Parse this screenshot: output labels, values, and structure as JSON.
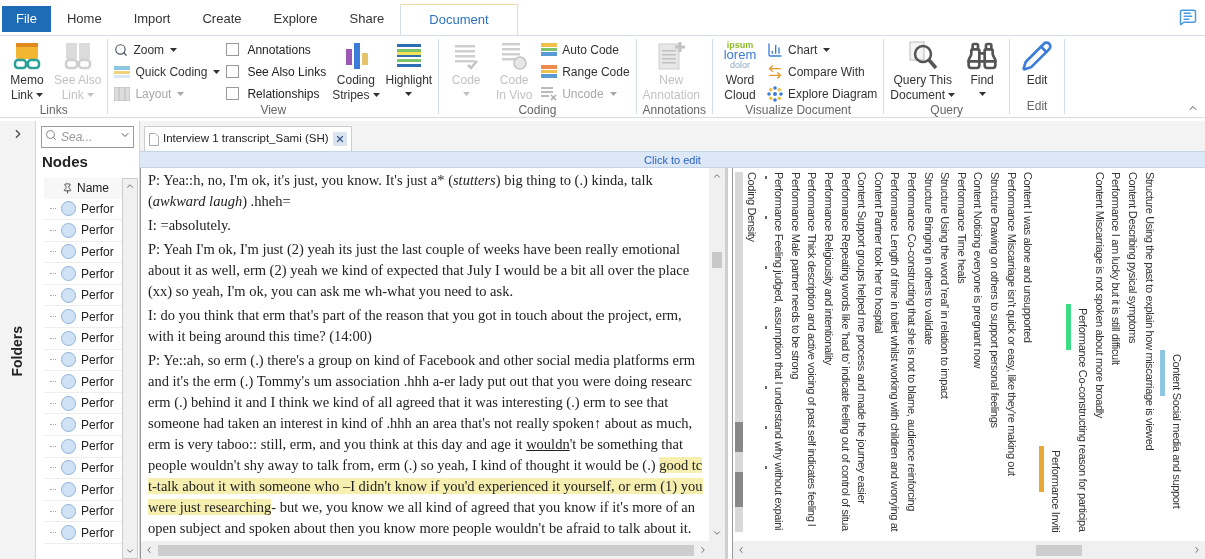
{
  "tabs": [
    {
      "label": "File",
      "kind": "file",
      "selected": false
    },
    {
      "label": "Home",
      "kind": "tab",
      "selected": false
    },
    {
      "label": "Import",
      "kind": "tab",
      "selected": false
    },
    {
      "label": "Create",
      "kind": "tab",
      "selected": false
    },
    {
      "label": "Explore",
      "kind": "tab",
      "selected": false
    },
    {
      "label": "Share",
      "kind": "tab",
      "selected": false
    },
    {
      "label": "Document",
      "kind": "tab",
      "selected": true
    }
  ],
  "ribbon": {
    "groups": [
      {
        "label": "Links",
        "items": [
          {
            "kind": "large",
            "lines": [
              "Memo",
              "Link"
            ],
            "dropdown": true,
            "disabled": false
          },
          {
            "kind": "large",
            "lines": [
              "See Also",
              "Link"
            ],
            "dropdown": true,
            "disabled": true
          }
        ]
      },
      {
        "label": "View",
        "items": [
          {
            "kind": "stack",
            "items": [
              {
                "kind": "small",
                "label": "Zoom",
                "dropdown": true,
                "disabled": false
              },
              {
                "kind": "small",
                "label": "Quick Coding",
                "dropdown": true,
                "disabled": false
              },
              {
                "kind": "small",
                "label": "Layout",
                "dropdown": true,
                "disabled": true
              }
            ]
          },
          {
            "kind": "stack",
            "items": [
              {
                "kind": "check",
                "label": "Annotations",
                "checked": false
              },
              {
                "kind": "check",
                "label": "See Also Links",
                "checked": false
              },
              {
                "kind": "check",
                "label": "Relationships",
                "checked": false
              }
            ]
          },
          {
            "kind": "large",
            "lines": [
              "Coding",
              "Stripes"
            ],
            "dropdown": true,
            "disabled": false
          },
          {
            "kind": "large",
            "lines": [
              "Highlight"
            ],
            "dropdown": true,
            "disabled": false
          }
        ]
      },
      {
        "label": "Coding",
        "items": [
          {
            "kind": "large",
            "lines": [
              "Code"
            ],
            "dropdown": true,
            "disabled": true
          },
          {
            "kind": "large",
            "lines": [
              "Code",
              "In Vivo"
            ],
            "dropdown": false,
            "disabled": true
          },
          {
            "kind": "stack",
            "items": [
              {
                "kind": "small",
                "label": "Auto Code",
                "dropdown": false,
                "disabled": false
              },
              {
                "kind": "small",
                "label": "Range Code",
                "dropdown": false,
                "disabled": false
              },
              {
                "kind": "small",
                "label": "Uncode",
                "dropdown": true,
                "disabled": true
              }
            ]
          }
        ]
      },
      {
        "label": "Annotations",
        "items": [
          {
            "kind": "large",
            "lines": [
              "New",
              "Annotation"
            ],
            "dropdown": false,
            "disabled": true
          }
        ]
      },
      {
        "label": "Visualize Document",
        "items": [
          {
            "kind": "large",
            "lines": [
              "Word",
              "Cloud"
            ],
            "dropdown": false,
            "disabled": false,
            "icon_words": [
              "ipsum",
              "lorem",
              "dolor"
            ]
          },
          {
            "kind": "stack",
            "items": [
              {
                "kind": "small",
                "label": "Chart",
                "dropdown": true,
                "disabled": false
              },
              {
                "kind": "small",
                "label": "Compare With",
                "dropdown": false,
                "disabled": false
              },
              {
                "kind": "small",
                "label": "Explore Diagram",
                "dropdown": false,
                "disabled": false
              }
            ]
          }
        ]
      },
      {
        "label": "Query",
        "items": [
          {
            "kind": "large",
            "lines": [
              "Query This",
              "Document"
            ],
            "dropdown": true,
            "disabled": false
          },
          {
            "kind": "large",
            "lines": [
              "Find"
            ],
            "dropdown": true,
            "disabled": false
          }
        ]
      },
      {
        "label": "Edit",
        "items": [
          {
            "kind": "large",
            "lines": [
              "Edit"
            ],
            "dropdown": false,
            "disabled": false
          }
        ]
      }
    ]
  },
  "navigation": {
    "panel_label": "Folders",
    "search": {
      "placeholder": "Sea..."
    },
    "title": "Nodes",
    "column": "Name",
    "items": [
      {
        "label": "Perfor"
      },
      {
        "label": "Perfor"
      },
      {
        "label": "Perfor"
      },
      {
        "label": "Perfor"
      },
      {
        "label": "Perfor"
      },
      {
        "label": "Perfor"
      },
      {
        "label": "Perfor"
      },
      {
        "label": "Perfor"
      },
      {
        "label": "Perfor"
      },
      {
        "label": "Perfor"
      },
      {
        "label": "Perfor"
      },
      {
        "label": "Perfor"
      },
      {
        "label": "Perfor"
      },
      {
        "label": "Perfor"
      },
      {
        "label": "Perfor"
      },
      {
        "label": "Perfor"
      }
    ]
  },
  "document": {
    "tab": "Interview 1 transcript_Sami (SH)",
    "edit_bar": "Click to edit",
    "paragraphs": [
      [
        [
          {
            "kind": "plain",
            "text": "P: Yea::h, no, I'm ok, it's just, you know. It's just a* (*stutters*) big thing to (.) kinda, talk"
          }
        ],
        [
          {
            "kind": "plain",
            "text": "(*awkward laugh*) .hheh="
          }
        ]
      ],
      [
        [
          {
            "kind": "plain",
            "text": "I: =absolutely."
          }
        ]
      ],
      [
        [
          {
            "kind": "plain",
            "text": "P: Yeah I'm ok, I'm just (2) yeah its just the last couple of weeks have been really emotional"
          }
        ],
        [
          {
            "kind": "plain",
            "text": "about it as well, erm (2) yeah we kind of expected that July I would be a bit all over the place"
          }
        ],
        [
          {
            "kind": "plain",
            "text": "(xx) so yeah, I'm ok, you can ask me wh-what you need to ask."
          }
        ]
      ],
      [
        [
          {
            "kind": "plain",
            "text": "I: do you think that erm that's part of the reason that you got in touch about the project, erm,"
          }
        ],
        [
          {
            "kind": "plain",
            "text": "with it being around this time? (14:00)"
          }
        ]
      ],
      [
        [
          {
            "kind": "plain",
            "text": "P: Ye::ah, so erm (.) there's a group on kind of Facebook and other social media platforms erm"
          }
        ],
        [
          {
            "kind": "plain",
            "text": "and it's the erm (.) Tommy's um association .hhh a-er lady put out that you were doing researc"
          }
        ],
        [
          {
            "kind": "plain",
            "text": "erm (.) behind it and I think we kind of all agreed that it was interesting (.) erm to see that"
          }
        ],
        [
          {
            "kind": "plain",
            "text": "someone had taken an interest in kind of .hhh an area that's not really spoken↑ about as much,"
          }
        ],
        [
          {
            "kind": "plain",
            "text": "erm is very taboo:: still, erm, and you think at this day and age it "
          },
          {
            "kind": "underline",
            "text": "wouldn"
          },
          {
            "kind": "plain",
            "text": "'t be something that"
          }
        ],
        [
          {
            "kind": "plain",
            "text": "people wouldn't shy away to talk from, erm (.) so yeah, I kind of thought it would be (.) "
          },
          {
            "kind": "highlight",
            "text": "good tc"
          }
        ],
        [
          {
            "kind": "highlight",
            "text": "t-talk about it with someone who –I didn't know if you'd experienced it yourself, or erm (1) you"
          }
        ],
        [
          {
            "kind": "highlight",
            "text": "were just researching"
          },
          {
            "kind": "plain",
            "text": "- but we, you know we all kind of agreed that you know if it's more of an"
          }
        ],
        [
          {
            "kind": "plain",
            "text": "open subject and spoken about then you know more people wouldn't be afraid to talk about it."
          }
        ]
      ]
    ]
  },
  "stripes": {
    "items": [
      {
        "label": "Coding Density"
      },
      {
        "label": "Performance Feeling judged, assumption that I understand why without expaini"
      },
      {
        "label": "Performance Male partner needs to be strong"
      },
      {
        "label": "Performance Thick description and active voicing of past self indicates feeling l"
      },
      {
        "label": "Performance Religiousity and intentionality"
      },
      {
        "label": "Performance Repeating words like 'had to' indicate feeling out of control of situa"
      },
      {
        "label": "Content Support groups helped me process and made the journey easier"
      },
      {
        "label": "Content Partner took her to hospital"
      },
      {
        "label": "Performance Length of time in toilet whilst working with children and worrying at"
      },
      {
        "label": "Performance Co-constructing that she is not to blame, audience reinforcing"
      },
      {
        "label": "Structure Bringing in others to validate"
      },
      {
        "label": "Structure Using the word 'real' in relation to impact"
      },
      {
        "label": "Performance Time heals"
      },
      {
        "label": "Content Noticing everyone is pregnant now"
      },
      {
        "label": "Structure Drawing on others to support personal feelings"
      },
      {
        "label": "Performance Miscarriage isn't quick or easy, like they're making out"
      },
      {
        "label": "Content I was alone and unsupported"
      },
      {
        "label": "Performance Inviti",
        "color": "#e8a838"
      },
      {
        "label": "Performance Co-constructing reason for participa",
        "color": "#3ddc84"
      },
      {
        "label": "Content Miscarriage is not spoken about more broadly"
      },
      {
        "label": "Performance I am lucky but it is still difficult"
      },
      {
        "label": "Content Describing pysical symptoms"
      },
      {
        "label": "Structure Using the past to explain how miscarriage is viewed"
      },
      {
        "label": "Content Social media and support",
        "color": "#8ec5e0"
      }
    ]
  }
}
